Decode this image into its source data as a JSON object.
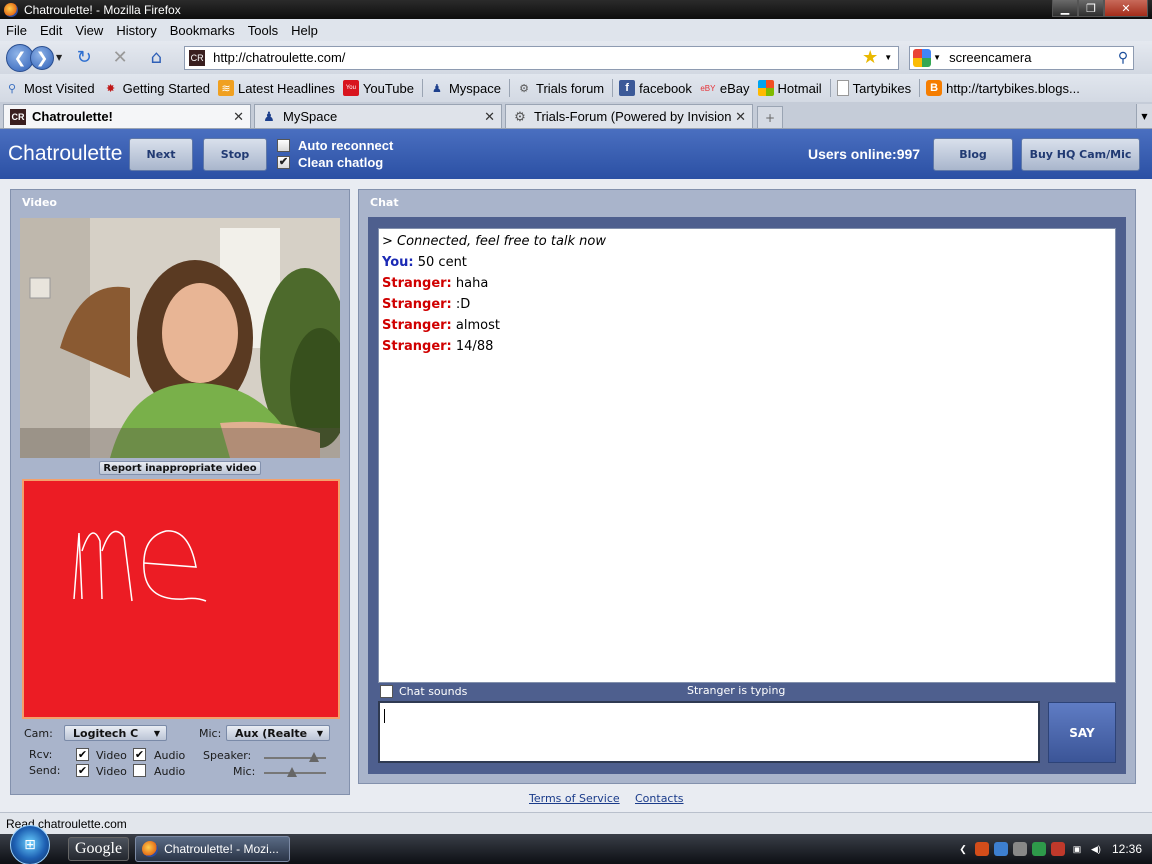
{
  "window": {
    "title": "Chatroulette! - Mozilla Firefox"
  },
  "menu": [
    "File",
    "Edit",
    "View",
    "History",
    "Bookmarks",
    "Tools",
    "Help"
  ],
  "nav": {
    "url": "http://chatroulette.com/",
    "search_value": "screencamera",
    "site_icon_text": "CR"
  },
  "bookmarks": [
    {
      "label": "Most Visited",
      "icon": "most-visited-icon"
    },
    {
      "label": "Getting Started",
      "icon": "getting-started-icon"
    },
    {
      "label": "Latest Headlines",
      "icon": "rss-icon"
    },
    {
      "label": "YouTube",
      "icon": "youtube-icon"
    },
    {
      "label": "Myspace",
      "icon": "myspace-icon"
    },
    {
      "label": "Trials forum",
      "icon": "gear-icon"
    },
    {
      "label": "facebook",
      "icon": "facebook-icon"
    },
    {
      "label": "eBay",
      "icon": "ebay-icon"
    },
    {
      "label": "Hotmail",
      "icon": "windows-icon"
    },
    {
      "label": "Tartybikes",
      "icon": "page-icon"
    },
    {
      "label": "http://tartybikes.blogs...",
      "icon": "blogger-icon"
    }
  ],
  "tabs": [
    {
      "label": "Chatroulette!",
      "active": true,
      "icon_text": "CR"
    },
    {
      "label": "MySpace",
      "active": false
    },
    {
      "label": "Trials-Forum (Powered by Invision ...",
      "active": false
    }
  ],
  "site": {
    "logo": "Chatroulette",
    "next_label": "Next",
    "stop_label": "Stop",
    "auto_reconnect_label": "Auto reconnect",
    "clean_chatlog_label": "Clean chatlog",
    "users_online": "Users online:997",
    "blog_label": "Blog",
    "buy_label": "Buy HQ Cam/Mic"
  },
  "video_panel": {
    "title": "Video",
    "report_label": "Report inappropriate video",
    "my_video_text": "me",
    "cam_label": "Cam:",
    "cam_value": "Logitech C",
    "mic_label": "Mic:",
    "mic_value": "Aux (Realte",
    "rcv_label": "Rcv:",
    "send_label": "Send:",
    "video_label": "Video",
    "audio_label": "Audio",
    "speaker_label": "Speaker:",
    "mic_slider_label": "Mic:",
    "speaker_level": 0.8,
    "mic_level": 0.45
  },
  "chat_panel": {
    "title": "Chat",
    "connected_text": "> Connected, feel free to talk now",
    "messages": [
      {
        "who": "You:",
        "text": "50 cent"
      },
      {
        "who": "Stranger:",
        "text": "haha"
      },
      {
        "who": "Stranger:",
        "text": ":D"
      },
      {
        "who": "Stranger:",
        "text": "almost"
      },
      {
        "who": "Stranger:",
        "text": "14/88"
      }
    ],
    "chat_sounds_label": "Chat sounds",
    "typing_status": "Stranger is typing",
    "say_label": "SAY"
  },
  "footer": {
    "terms": "Terms of Service",
    "contacts": "Contacts"
  },
  "status_bar": "Read chatroulette.com",
  "taskbar": {
    "google_label": "Google",
    "task_label": "Chatroulette! - Mozi...",
    "clock": "12:36"
  },
  "colors": {
    "header_blue": "#2b50a4",
    "stranger_red": "#d00000",
    "you_blue": "#1b2ab5",
    "my_video_bg": "#ec1c24"
  }
}
